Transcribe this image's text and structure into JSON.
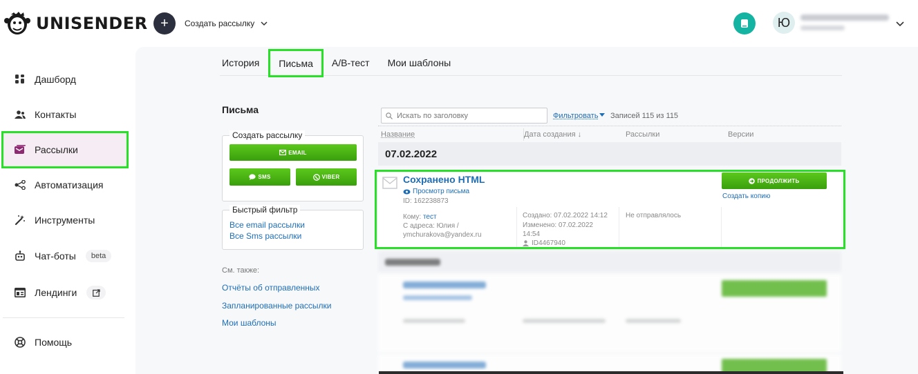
{
  "header": {
    "logo_text": "UNISENDER",
    "create_label": "Создать рассылку",
    "avatar_letter": "Ю"
  },
  "sidebar": {
    "items": [
      {
        "label": "Дашборд",
        "icon": "dashboard-icon"
      },
      {
        "label": "Контакты",
        "icon": "contacts-icon"
      },
      {
        "label": "Рассылки",
        "icon": "mail-icon"
      },
      {
        "label": "Автоматизация",
        "icon": "automation-icon"
      },
      {
        "label": "Инструменты",
        "icon": "tools-icon"
      },
      {
        "label": "Чат-боты",
        "icon": "bot-icon",
        "badge": "beta"
      },
      {
        "label": "Лендинги",
        "icon": "landing-icon"
      },
      {
        "label": "Помощь",
        "icon": "help-icon"
      }
    ]
  },
  "tabs": [
    "История",
    "Письма",
    "A/B-тест",
    "Мои шаблоны"
  ],
  "left_panel": {
    "title": "Письма",
    "create_legend": "Создать рассылку",
    "btn_email": "EMAIL",
    "btn_sms": "SMS",
    "btn_viber": "VIBER",
    "filter_legend": "Быстрый фильтр",
    "filter_links": [
      "Все email рассылки",
      "Все Sms рассылки"
    ],
    "see_also": "См. также:",
    "see_links": [
      "Отчёты об отправленных",
      "Запланированные рассылки",
      "Мои шаблоны"
    ]
  },
  "list": {
    "search_placeholder": "Искать по заголовку",
    "filter_label": "Фильтровать",
    "records": "Записей 115 из 115",
    "columns": [
      "Название",
      "Дата создания ↓",
      "Рассылки",
      "Версии"
    ],
    "date_group": "07.02.2022",
    "row": {
      "title": "Сохранено HTML",
      "view_link": "Просмотр письма",
      "id": "ID: 162238873",
      "to_label": "Кому:",
      "to_value": "тест",
      "from_label": "С адреса: Юлия /",
      "from_email": "ymchurakova@yandex.ru",
      "created": "Создано: 07.02.2022 14:12",
      "modified": "Изменено: 07.02.2022",
      "modified_time": "14:54",
      "user_id": "ID4467940",
      "status": "Не отправлялось",
      "continue_btn": "ПРОДОЛЖИТЬ",
      "copy_link": "Создать копию"
    }
  },
  "colors": {
    "accent_green": "#3a9f0c",
    "link_blue": "#1e6db5",
    "teal": "#15b3a2",
    "highlight": "#28e028"
  }
}
